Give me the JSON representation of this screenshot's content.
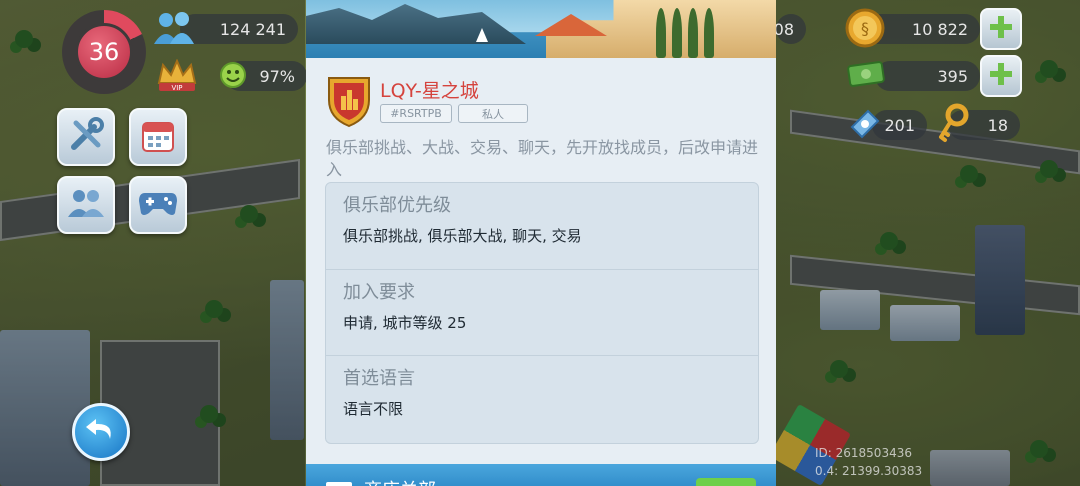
{
  "hud": {
    "level": "36",
    "population": "124 241",
    "happiness": "97%",
    "simoleons": "10 822",
    "simcash": "395",
    "neosimoleons": "201",
    "keys": "18",
    "left_edge_value": "08",
    "vip_label": "VIP"
  },
  "club": {
    "name": "LQY-星之城",
    "tag": "#RSRTPB",
    "privacy": "私人",
    "description": "俱乐部挑战、大战、交易、聊天，先开放找成员，后改申请进入"
  },
  "info": {
    "priority_label": "俱乐部优先级",
    "priority_value": "俱乐部挑战, 俱乐部大战, 聊天, 交易",
    "requirements_label": "加入要求",
    "requirements_value": "申请, 城市等级 25",
    "language_label": "首选语言",
    "language_value": "语言不限"
  },
  "footer": {
    "title": "商店关部"
  },
  "coords": {
    "line1": "ID: 2618503436",
    "line2": "0.4: 21399.30383"
  },
  "colors": {
    "club_name": "#d5433d",
    "panel_bg": "#e7eef4",
    "info_box": "#d8e3ec",
    "plus_green": "#6ec04a",
    "back_blue": "#1774c4"
  }
}
